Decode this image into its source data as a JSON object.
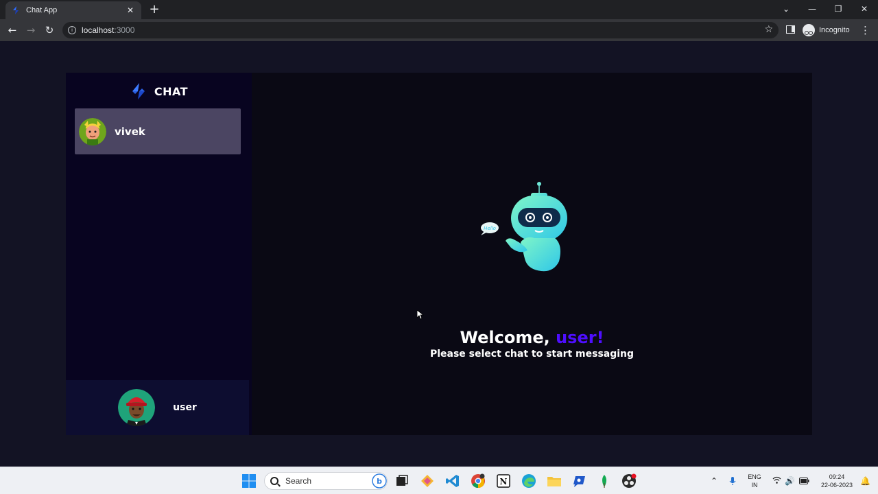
{
  "browser": {
    "tab_title": "Chat App",
    "url_host": "localhost",
    "url_port": ":3000",
    "incognito_label": "Incognito"
  },
  "app": {
    "brand_title": "CHAT",
    "contacts": [
      {
        "name": "vivek",
        "selected": true
      }
    ],
    "current_user": {
      "name": "user"
    },
    "welcome": {
      "greeting": "Welcome, ",
      "username": "user!",
      "subtitle": "Please select chat to start messaging"
    },
    "robot_bubble": "Hello",
    "colors": {
      "accent": "#4e0eff",
      "page_bg": "#131324",
      "sidebar_bg": "#080420",
      "selected_contact_bg": "#4b4562",
      "current_user_bg": "#0d0d30",
      "main_bg": "#0a0914"
    }
  },
  "taskbar": {
    "search_placeholder": "Search",
    "lang_line1": "ENG",
    "lang_line2": "IN",
    "time": "09:24",
    "date": "22-06-2023",
    "pinned_icons": [
      "windows-start-icon",
      "search-icon",
      "bing-icon",
      "file-explorer-icon",
      "toolbox-icon",
      "vscode-icon",
      "chrome-icon",
      "notion-icon",
      "edge-icon",
      "folder-icon",
      "chat-icon",
      "mongodb-icon",
      "obs-icon"
    ]
  }
}
